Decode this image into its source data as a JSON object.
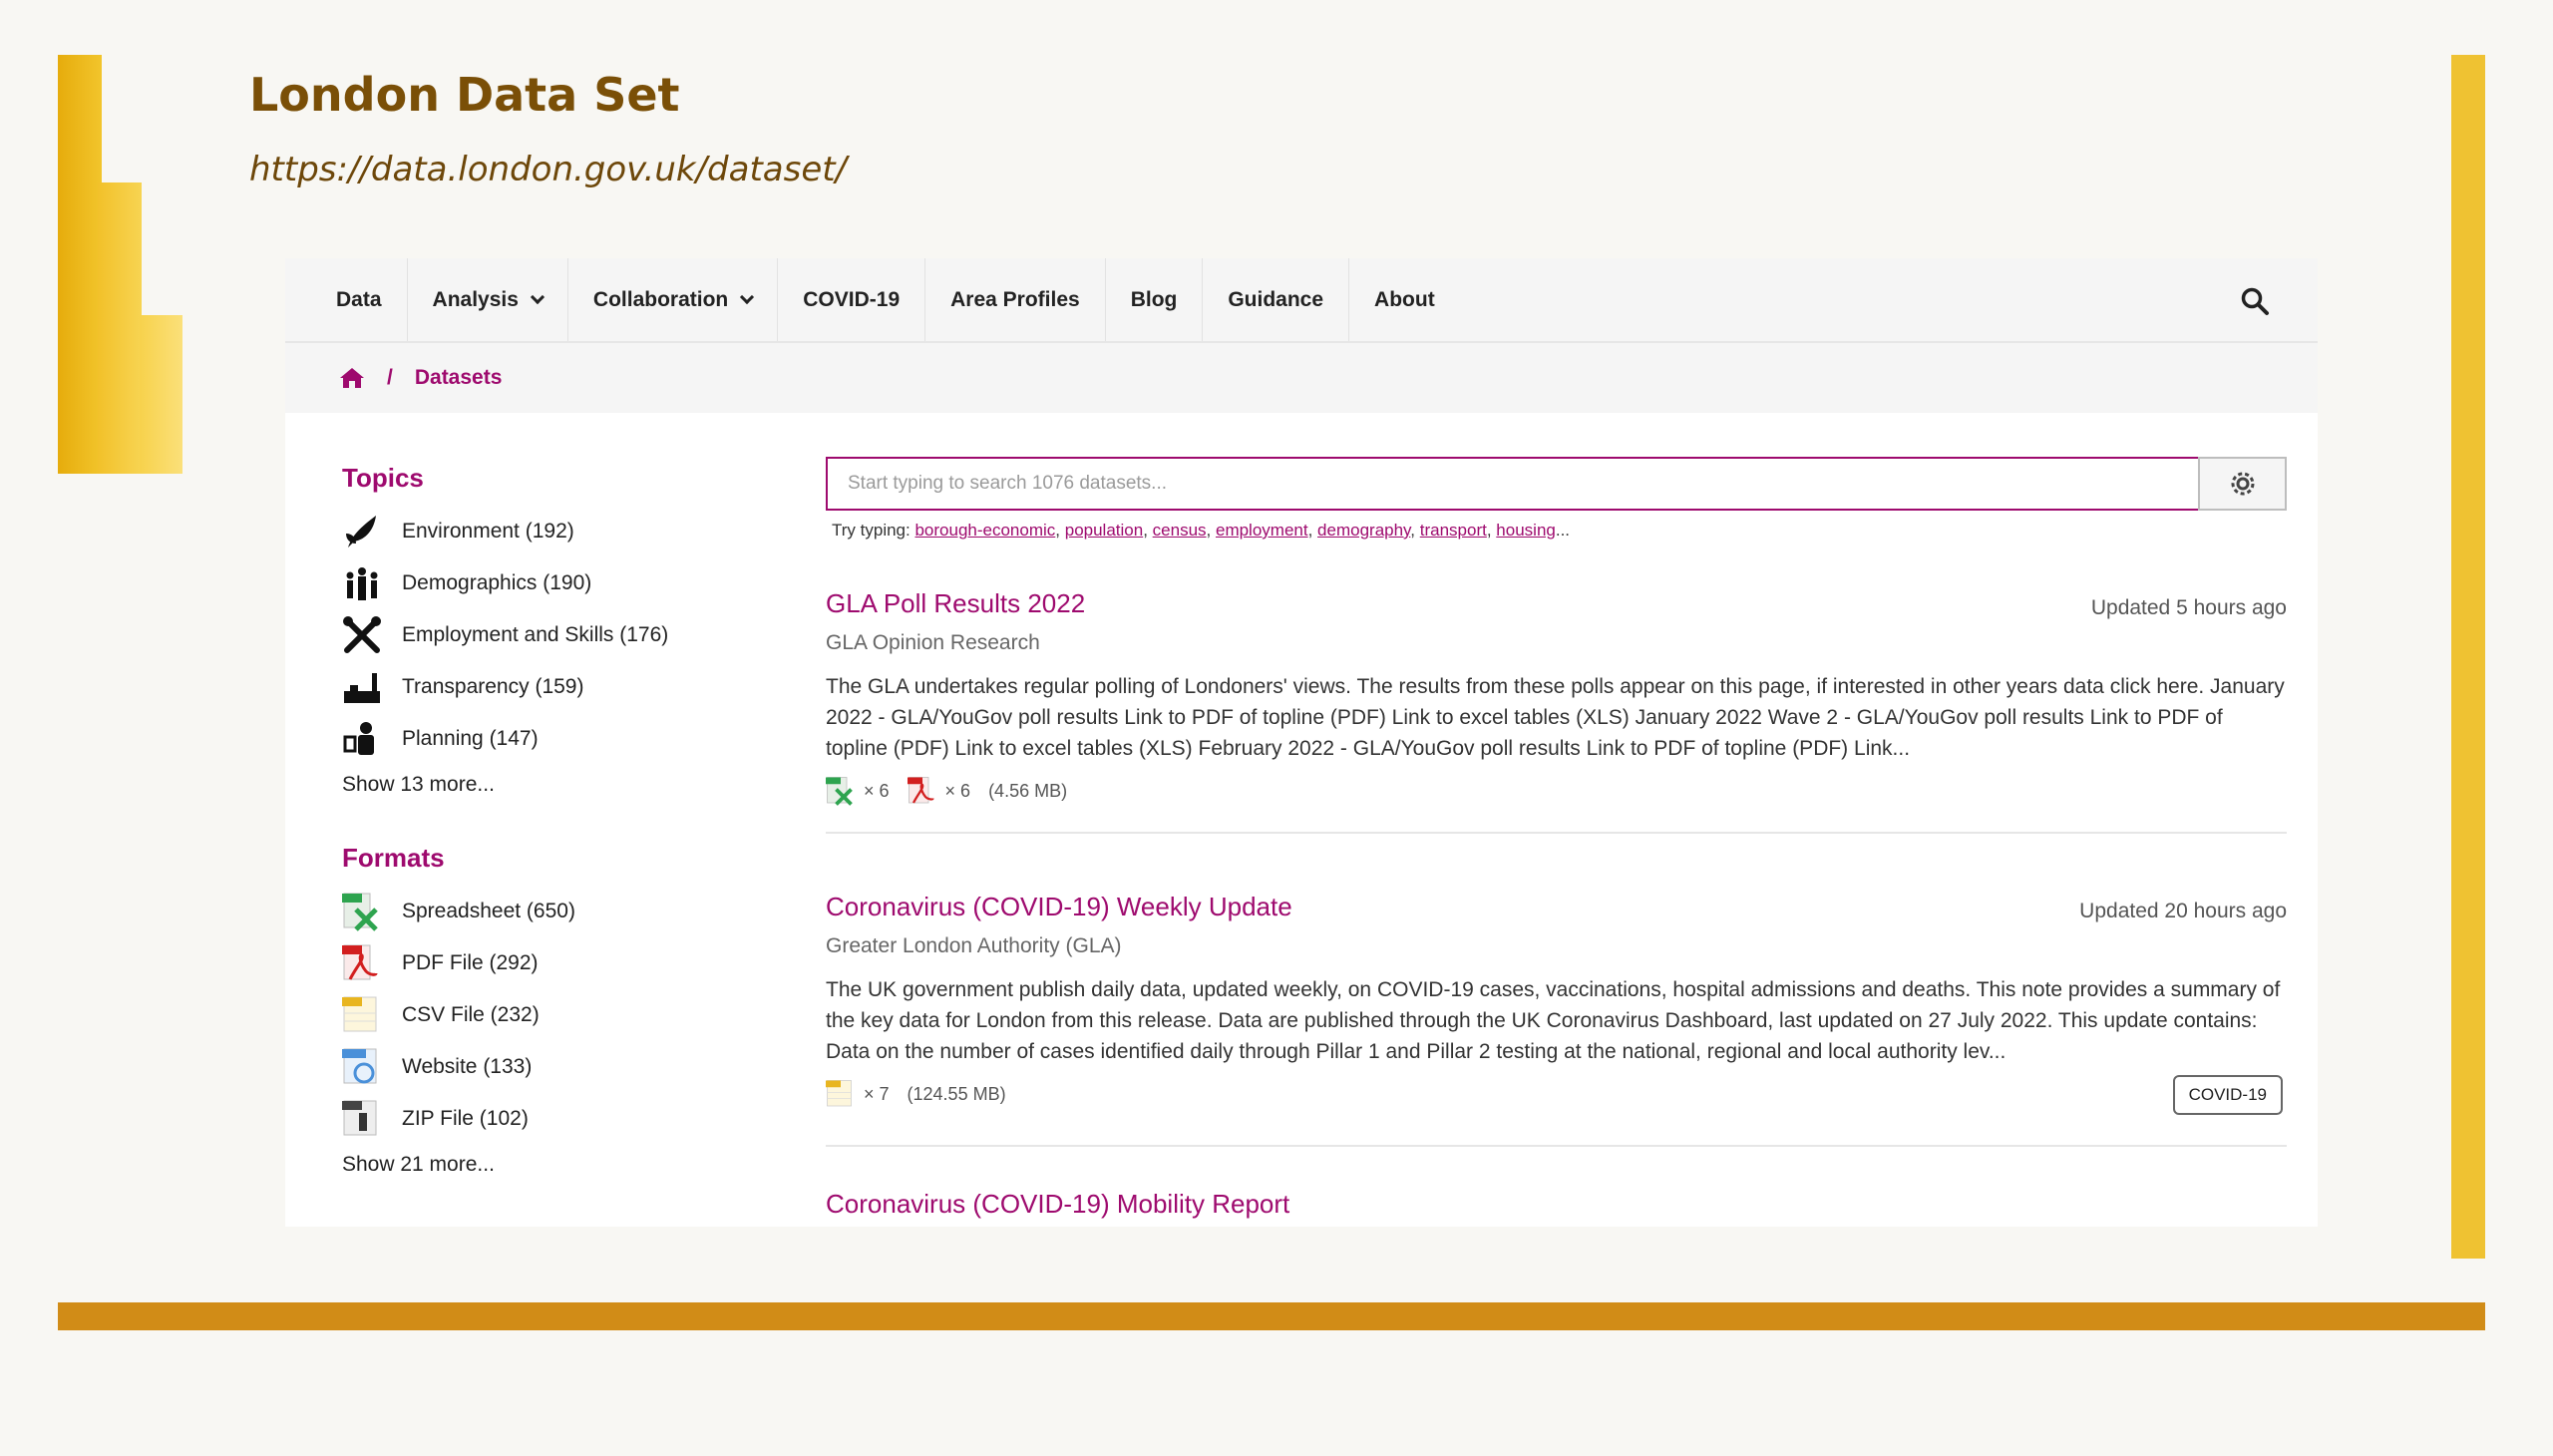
{
  "slide": {
    "title": "London Data Set",
    "url": "https://data.london.gov.uk/dataset/"
  },
  "nav": {
    "items": [
      {
        "label": "Data",
        "dropdown": false
      },
      {
        "label": "Analysis",
        "dropdown": true
      },
      {
        "label": "Collaboration",
        "dropdown": true
      },
      {
        "label": "COVID-19",
        "dropdown": false
      },
      {
        "label": "Area Profiles",
        "dropdown": false
      },
      {
        "label": "Blog",
        "dropdown": false
      },
      {
        "label": "Guidance",
        "dropdown": false
      },
      {
        "label": "About",
        "dropdown": false
      }
    ],
    "search_icon": "search-icon"
  },
  "breadcrumb": {
    "separator": "/",
    "current": "Datasets"
  },
  "sidebar": {
    "topics": {
      "heading": "Topics",
      "items": [
        {
          "label": "Environment (192)",
          "icon": "environment-icon"
        },
        {
          "label": "Demographics (190)",
          "icon": "demographics-icon"
        },
        {
          "label": "Employment and Skills (176)",
          "icon": "employment-icon"
        },
        {
          "label": "Transparency (159)",
          "icon": "transparency-icon"
        },
        {
          "label": "Planning (147)",
          "icon": "planning-icon"
        }
      ],
      "show_more": "Show 13 more..."
    },
    "formats": {
      "heading": "Formats",
      "items": [
        {
          "label": "Spreadsheet (650)",
          "icon": "spreadsheet-icon"
        },
        {
          "label": "PDF File (292)",
          "icon": "pdf-icon"
        },
        {
          "label": "CSV File (232)",
          "icon": "csv-icon"
        },
        {
          "label": "Website (133)",
          "icon": "website-icon"
        },
        {
          "label": "ZIP File (102)",
          "icon": "zip-icon"
        }
      ],
      "show_more": "Show 21 more..."
    }
  },
  "search": {
    "placeholder": "Start typing to search 1076 datasets...",
    "try_label": "Try typing:",
    "suggestions": [
      "borough-economic",
      "population",
      "census",
      "employment",
      "demography",
      "transport",
      "housing"
    ],
    "ellipsis": "..."
  },
  "results": [
    {
      "title": "GLA Poll Results 2022",
      "updated": "Updated 5 hours ago",
      "publisher": "GLA Opinion Research",
      "description": "The GLA undertakes regular polling of Londoners' views. The results from these polls appear on this page, if interested in other years data click here. January 2022 - GLA/YouGov poll results Link to PDF of topline (PDF) Link to excel tables (XLS) January 2022 Wave 2 - GLA/YouGov poll results Link to PDF of topline (PDF) Link to excel tables (XLS) February 2022 - GLA/YouGov poll results Link to PDF of topline (PDF) Link...",
      "files": [
        {
          "icon": "spreadsheet-icon",
          "count": "× 6"
        },
        {
          "icon": "pdf-icon",
          "count": "× 6"
        }
      ],
      "size": "(4.56 MB)"
    },
    {
      "title": "Coronavirus (COVID-19) Weekly Update",
      "updated": "Updated 20 hours ago",
      "publisher": "Greater London Authority (GLA)",
      "description": "The UK government publish daily data, updated weekly, on COVID-19 cases, vaccinations, hospital admissions and deaths. This note provides a summary of the key data for London from this release. Data are published through the UK Coronavirus Dashboard, last updated on 27 July 2022. This update contains: Data on the number of cases identified daily through Pillar 1 and Pillar 2 testing at the national, regional and local authority lev...",
      "files": [
        {
          "icon": "csv-icon",
          "count": "× 7"
        }
      ],
      "size": "(124.55 MB)",
      "tag": "COVID-19"
    },
    {
      "title": "Coronavirus (COVID-19) Mobility Report"
    }
  ],
  "colors": {
    "accent": "#9e0a6e",
    "slide_title": "#7a4f07",
    "bar_gold": "#efc232",
    "bar_bottom": "#d18c17"
  }
}
